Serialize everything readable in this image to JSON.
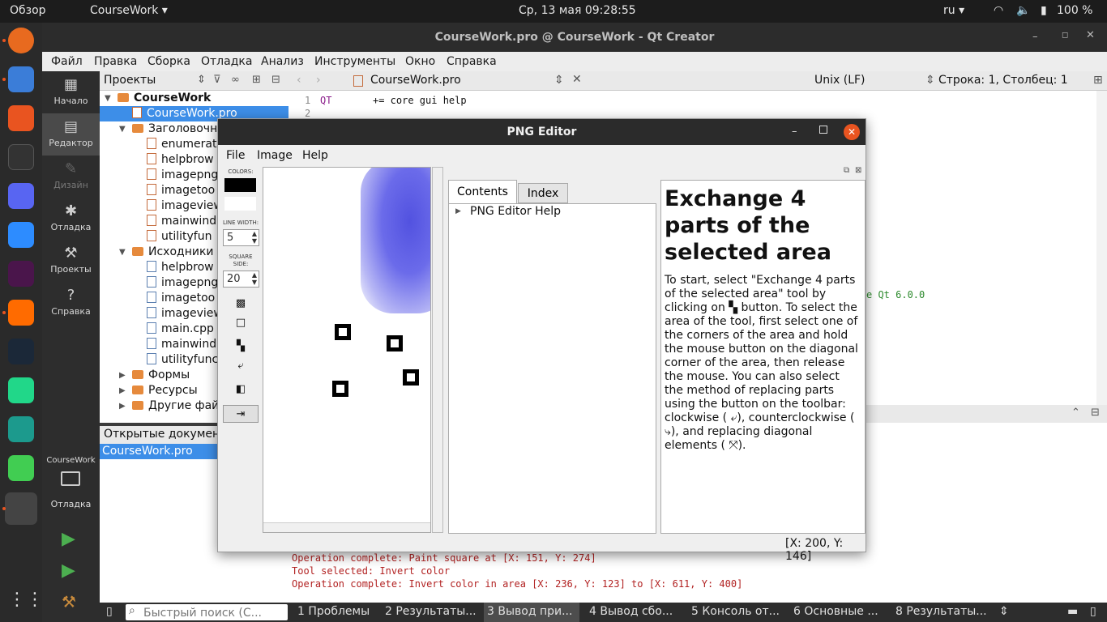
{
  "topbar": {
    "overview": "Обзор",
    "app": "CourseWork ▾",
    "datetime": "Ср, 13 мая  09:28:55",
    "lang": "ru ▾",
    "battery": "100 %"
  },
  "qt": {
    "title": "CourseWork.pro @ CourseWork - Qt Creator",
    "menu": [
      "Файл",
      "Правка",
      "Сборка",
      "Отладка",
      "Анализ",
      "Инструменты",
      "Окно",
      "Справка"
    ],
    "modes": [
      "Начало",
      "Редактор",
      "Дизайн",
      "Отладка",
      "Проекты",
      "Справка"
    ],
    "kit_project": "CourseWork",
    "kit_mode": "Отладка",
    "projects_label": "Проекты",
    "tree": {
      "root": "CourseWork",
      "pro": "CourseWork.pro",
      "headers": "Заголовочн",
      "header_files": [
        "enumerat",
        "helpbrow",
        "imagepng",
        "imagetoo",
        "imageview",
        "mainwind",
        "utilityfun"
      ],
      "sources": "Исходники",
      "source_files": [
        "helpbrow",
        "imagepng",
        "imagetoo",
        "imageview",
        "main.cpp",
        "mainwind",
        "utilityfunc"
      ],
      "forms": "Формы",
      "resources": "Ресурсы",
      "other": "Другие фай"
    },
    "open_docs_label": "Открытые документ",
    "open_doc": "CourseWork.pro",
    "editor": {
      "filename": "CourseWork.pro",
      "line_ending": "Unix (LF)",
      "position": "Строка: 1, Столбец: 1",
      "line1_num": "1",
      "line1_kw": "QT",
      "line1_rest": "+= core gui help",
      "line2_num": "2",
      "partial": "e Qt 6.0.0"
    },
    "output_lines": [
      "Operation complete: Paint square at [X: 151, Y: 274]",
      "Tool selected: Invert color",
      "Operation complete: Invert color in area [X: 236, Y: 123] to [X: 611, Y: 400]"
    ],
    "status": {
      "search_placeholder": "Быстрый поиск (С...",
      "tabs": [
        "1  Проблемы",
        "2  Результаты...",
        "3  Вывод при...",
        "4  Вывод сбо...",
        "5  Консоль от...",
        "6  Основные ...",
        "8  Результаты..."
      ]
    }
  },
  "dialog": {
    "title": "PNG Editor",
    "menu": [
      "File",
      "Image",
      "Help"
    ],
    "colors_label": "COLORS:",
    "line_width_label": "LINE WIDTH:",
    "line_width_value": "5",
    "square_side_label": "SQUARE SIDE:",
    "square_side_value": "20",
    "tabs": [
      "Contents",
      "Index"
    ],
    "tree_item": "PNG Editor Help",
    "help_title": "Exchange 4 parts of the selected area",
    "help_text_1": "To start, select \"Exchange 4 parts of the selected area\" tool by clicking on",
    "help_text_2": "button. To select the area of the tool, first select one of the corners of the area and hold the mouse button on the diagonal corner of the area, then release the mouse. You can also select the method of replacing parts using the button on the toolbar: clockwise (",
    "help_text_3": "), counterclockwise (",
    "help_text_4": "), and replacing diagonal elements (",
    "help_text_5": ").",
    "coords": "[X: 200, Y: 146]"
  }
}
